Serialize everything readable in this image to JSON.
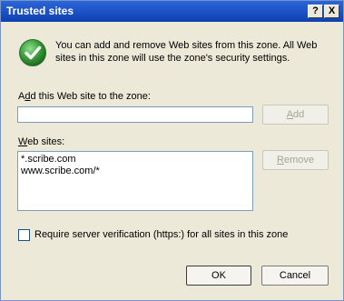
{
  "dialog": {
    "title": "Trusted sites",
    "help_button": "?",
    "close_button": "X"
  },
  "info": {
    "icon": "green-check-icon",
    "text": "You can add and remove Web sites from this zone. All Web sites in this zone will use the zone's security settings."
  },
  "add_section": {
    "label_prefix": "A",
    "label_accel": "d",
    "label_rest": "d this Web site to the zone:",
    "input_value": "",
    "add_button_prefix": "",
    "add_button_accel": "A",
    "add_button_rest": "dd"
  },
  "sites_section": {
    "label_accel": "W",
    "label_rest": "eb sites:",
    "sites": [
      "*.scribe.com",
      "www.scribe.com/*"
    ],
    "remove_button_accel": "R",
    "remove_button_rest": "emove"
  },
  "verification": {
    "checked": false,
    "label": "Require server verification (https:) for all sites in this zone"
  },
  "footer": {
    "ok_label": "OK",
    "cancel_label": "Cancel"
  },
  "colors": {
    "titlebar": "#0f40ae",
    "dialog_bg": "#ece9d8",
    "check_green": "#3a9a3a"
  }
}
